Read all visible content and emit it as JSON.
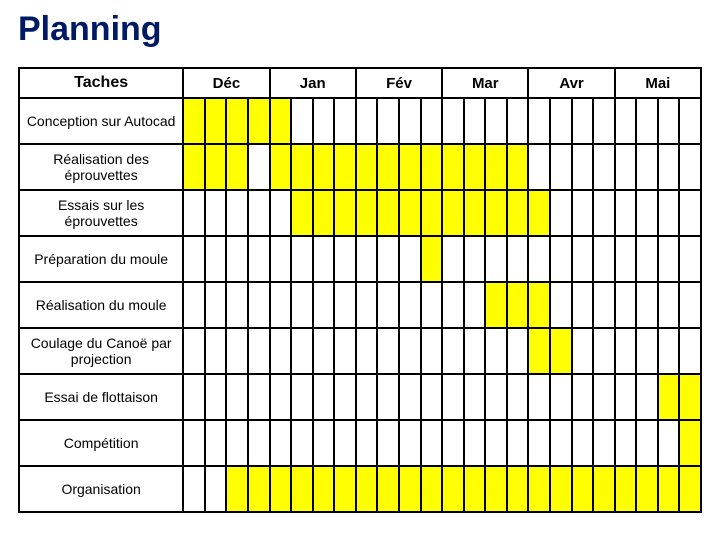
{
  "title": "Planning",
  "tasks_header": "Taches",
  "months": [
    "Déc",
    "Jan",
    "Fév",
    "Mar",
    "Avr",
    "Mai"
  ],
  "weeks_per_month": 4,
  "tasks": [
    "Conception sur Autocad",
    "Réalisation des éprouvettes",
    "Essais sur les éprouvettes",
    "Préparation du moule",
    "Réalisation du moule",
    "Coulage du Canoë par projection",
    "Essai de flottaison",
    "Compétition",
    "Organisation"
  ],
  "chart_data": {
    "type": "bar",
    "title": "Planning",
    "xlabel": "",
    "ylabel": "",
    "categories": [
      "Déc",
      "Déc",
      "Déc",
      "Déc",
      "Jan",
      "Jan",
      "Jan",
      "Jan",
      "Fév",
      "Fév",
      "Fév",
      "Fév",
      "Mar",
      "Mar",
      "Mar",
      "Mar",
      "Avr",
      "Avr",
      "Avr",
      "Avr",
      "Mai",
      "Mai",
      "Mai",
      "Mai"
    ],
    "series": [
      {
        "name": "Conception sur Autocad",
        "values": [
          1,
          1,
          1,
          1,
          1,
          0,
          0,
          0,
          0,
          0,
          0,
          0,
          0,
          0,
          0,
          0,
          0,
          0,
          0,
          0,
          0,
          0,
          0,
          0
        ]
      },
      {
        "name": "Réalisation des éprouvettes",
        "values": [
          1,
          1,
          1,
          0,
          1,
          1,
          1,
          1,
          1,
          1,
          1,
          1,
          1,
          1,
          1,
          1,
          0,
          0,
          0,
          0,
          0,
          0,
          0,
          0
        ]
      },
      {
        "name": "Essais sur les éprouvettes",
        "values": [
          0,
          0,
          0,
          0,
          0,
          1,
          1,
          1,
          1,
          1,
          1,
          1,
          1,
          1,
          1,
          1,
          1,
          0,
          0,
          0,
          0,
          0,
          0,
          0
        ]
      },
      {
        "name": "Préparation du moule",
        "values": [
          0,
          0,
          0,
          0,
          0,
          0,
          0,
          0,
          0,
          0,
          0,
          1,
          0,
          0,
          0,
          0,
          0,
          0,
          0,
          0,
          0,
          0,
          0,
          0
        ]
      },
      {
        "name": "Réalisation du moule",
        "values": [
          0,
          0,
          0,
          0,
          0,
          0,
          0,
          0,
          0,
          0,
          0,
          0,
          0,
          0,
          1,
          1,
          1,
          0,
          0,
          0,
          0,
          0,
          0,
          0
        ]
      },
      {
        "name": "Coulage du Canoë par projection",
        "values": [
          0,
          0,
          0,
          0,
          0,
          0,
          0,
          0,
          0,
          0,
          0,
          0,
          0,
          0,
          0,
          0,
          1,
          1,
          0,
          0,
          0,
          0,
          0,
          0
        ]
      },
      {
        "name": "Essai de flottaison",
        "values": [
          0,
          0,
          0,
          0,
          0,
          0,
          0,
          0,
          0,
          0,
          0,
          0,
          0,
          0,
          0,
          0,
          0,
          0,
          0,
          0,
          0,
          0,
          1,
          1
        ]
      },
      {
        "name": "Compétition",
        "values": [
          0,
          0,
          0,
          0,
          0,
          0,
          0,
          0,
          0,
          0,
          0,
          0,
          0,
          0,
          0,
          0,
          0,
          0,
          0,
          0,
          0,
          0,
          0,
          1
        ]
      },
      {
        "name": "Organisation",
        "values": [
          0,
          0,
          1,
          1,
          1,
          1,
          1,
          1,
          1,
          1,
          1,
          1,
          1,
          1,
          1,
          1,
          1,
          1,
          1,
          1,
          1,
          1,
          1,
          1
        ]
      }
    ]
  }
}
